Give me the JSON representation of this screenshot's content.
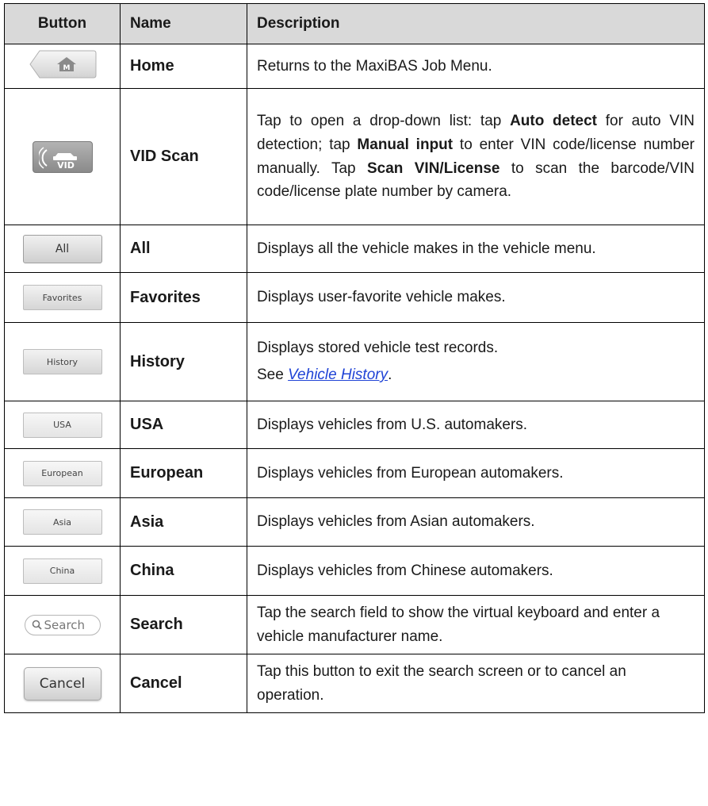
{
  "headers": {
    "button": "Button",
    "name": "Name",
    "description": "Description"
  },
  "rows": [
    {
      "button_pic": "home-icon",
      "name": "Home",
      "desc": "Returns to the MaxiBAS Job Menu."
    },
    {
      "button_pic": "vid-scan-icon",
      "name": "VID Scan",
      "desc_parts": [
        "Tap to open a drop-down list: tap ",
        "Auto detect",
        " for auto VIN detection; tap ",
        "Manual input",
        " to enter VIN code/license number manually. Tap ",
        "Scan VIN/License",
        " to scan the barcode/VIN code/license plate number by camera."
      ]
    },
    {
      "button_label": "All",
      "name": "All",
      "desc": "Displays all the vehicle makes in the vehicle menu."
    },
    {
      "button_label": "Favorites",
      "name": "Favorites",
      "desc": "Displays user-favorite vehicle makes."
    },
    {
      "button_label": "History",
      "name": "History",
      "desc": "Displays stored vehicle test records.",
      "see_prefix": "See ",
      "see_link": "Vehicle History",
      "see_suffix": "."
    },
    {
      "button_label": "USA",
      "name": "USA",
      "desc": "Displays vehicles from U.S. automakers."
    },
    {
      "button_label": "European",
      "name": "European",
      "desc": "Displays vehicles from European automakers."
    },
    {
      "button_label": "Asia",
      "name": "Asia",
      "desc": "Displays vehicles from Asian automakers."
    },
    {
      "button_label": "China",
      "name": "China",
      "desc": "Displays vehicles from Chinese automakers."
    },
    {
      "button_label": "Search",
      "button_icon": "search-icon",
      "name": "Search",
      "desc": "Tap the search field to show the virtual keyboard and enter a vehicle manufacturer name."
    },
    {
      "button_label": "Cancel",
      "name": "Cancel",
      "desc": "Tap this button to exit the search screen or to cancel an operation."
    }
  ],
  "colors": {
    "header_bg": "#d9d9d9",
    "link": "#1f43d6",
    "border": "#000000"
  }
}
